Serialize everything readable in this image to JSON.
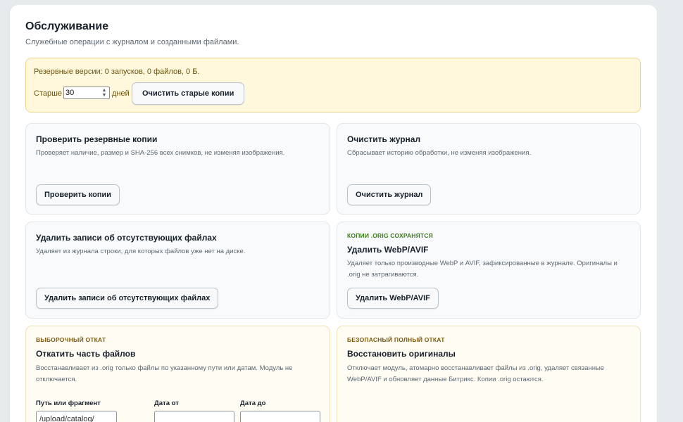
{
  "page": {
    "title": "Обслуживание",
    "subtitle": "Служебные операции с журналом и созданными файлами."
  },
  "backup_notice": {
    "info": "Резервные версии: 0 запусков, 0 файлов, 0 Б.",
    "older_label": "Старше",
    "days_value": "30",
    "days_label": "дней",
    "clean_button": "Очистить старые копии"
  },
  "cards": {
    "verify": {
      "title": "Проверить резервные копии",
      "description": "Проверяет наличие, размер и SHA-256 всех снимков, не изменяя изображения.",
      "button": "Проверить копии"
    },
    "clear_log": {
      "title": "Очистить журнал",
      "description": "Сбрасывает историю обработки, не изменяя изображения.",
      "button": "Очистить журнал"
    },
    "remove_missing": {
      "title": "Удалить записи об отсутствующих файлах",
      "description": "Удаляет из журнала строки, для которых файлов уже нет на диске.",
      "button": "Удалить записи об отсутствующих файлах"
    },
    "delete_webp": {
      "tag": "КОПИИ .ORIG СОХРАНЯТСЯ",
      "title": "Удалить WebP/AVIF",
      "description": "Удаляет только производные WebP и AVIF, зафиксированные в журнале. Оригиналы и .orig не затрагиваются.",
      "button": "Удалить WebP/AVIF"
    },
    "partial_rollback": {
      "tag": "ВЫБОРОЧНЫЙ ОТКАТ",
      "title": "Откатить часть файлов",
      "description": "Восстанавливает из .orig только файлы по указанному пути или датам. Модуль не отключается.",
      "path_label": "Путь или фрагмент",
      "path_placeholder": "/upload/catalog/",
      "date_from_label": "Дата от",
      "date_to_label": "Дата до"
    },
    "full_rollback": {
      "tag": "БЕЗОПАСНЫЙ ПОЛНЫЙ ОТКАТ",
      "title": "Восстановить оригиналы",
      "description": "Отключает модуль, атомарно восстанавливает файлы из .orig, удаляет связанные WebP/AVIF и обновляет данные Битрикс. Копии .orig остаются."
    }
  },
  "colors": {
    "background": "#e6eced",
    "notice_bg": "#fff8dd",
    "tag_green": "#3d7a1e",
    "tag_brown": "#7a5a10"
  }
}
